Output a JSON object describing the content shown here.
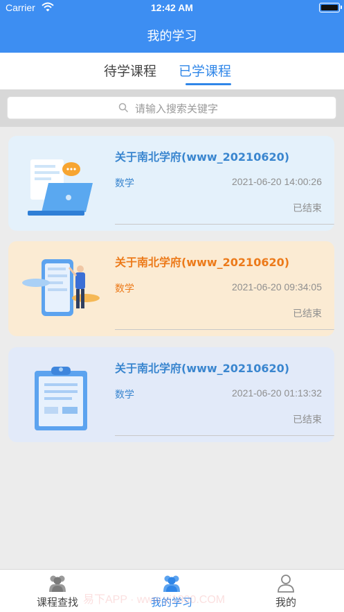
{
  "status_bar": {
    "carrier": "Carrier",
    "time": "12:42 AM"
  },
  "header": {
    "title": "我的学习"
  },
  "tabs": [
    {
      "label": "待学课程",
      "active": false
    },
    {
      "label": "已学课程",
      "active": true
    }
  ],
  "search": {
    "placeholder": "请输入搜索关键字"
  },
  "courses": [
    {
      "title": "关于南北学府(www_20210620)",
      "subject": "数学",
      "time": "2021-06-20 14:00:26",
      "status": "已结束",
      "title_color": "#3a86cf",
      "bg_color": "#e4f1fb",
      "illustration": "laptop-illustration"
    },
    {
      "title": "关于南北学府(www_20210620)",
      "subject": "数学",
      "time": "2021-06-20 09:34:05",
      "status": "已结束",
      "title_color": "#ec7a1a",
      "bg_color": "#fbebd3",
      "illustration": "person-phone-illustration"
    },
    {
      "title": "关于南北学府(www_20210620)",
      "subject": "数学",
      "time": "2021-06-20 01:13:32",
      "status": "已结束",
      "title_color": "#3a86cf",
      "bg_color": "#e2eaf9",
      "illustration": "clipboard-illustration"
    }
  ],
  "tab_bar": [
    {
      "label": "课程查找",
      "icon": "group-icon",
      "active": false
    },
    {
      "label": "我的学习",
      "icon": "group-icon",
      "active": true
    },
    {
      "label": "我的",
      "icon": "user-icon",
      "active": false
    }
  ],
  "watermark": "易下APP · www.yi1800.COM",
  "colors": {
    "primary": "#3d8ef2",
    "active_tab": "#2f86e8"
  }
}
